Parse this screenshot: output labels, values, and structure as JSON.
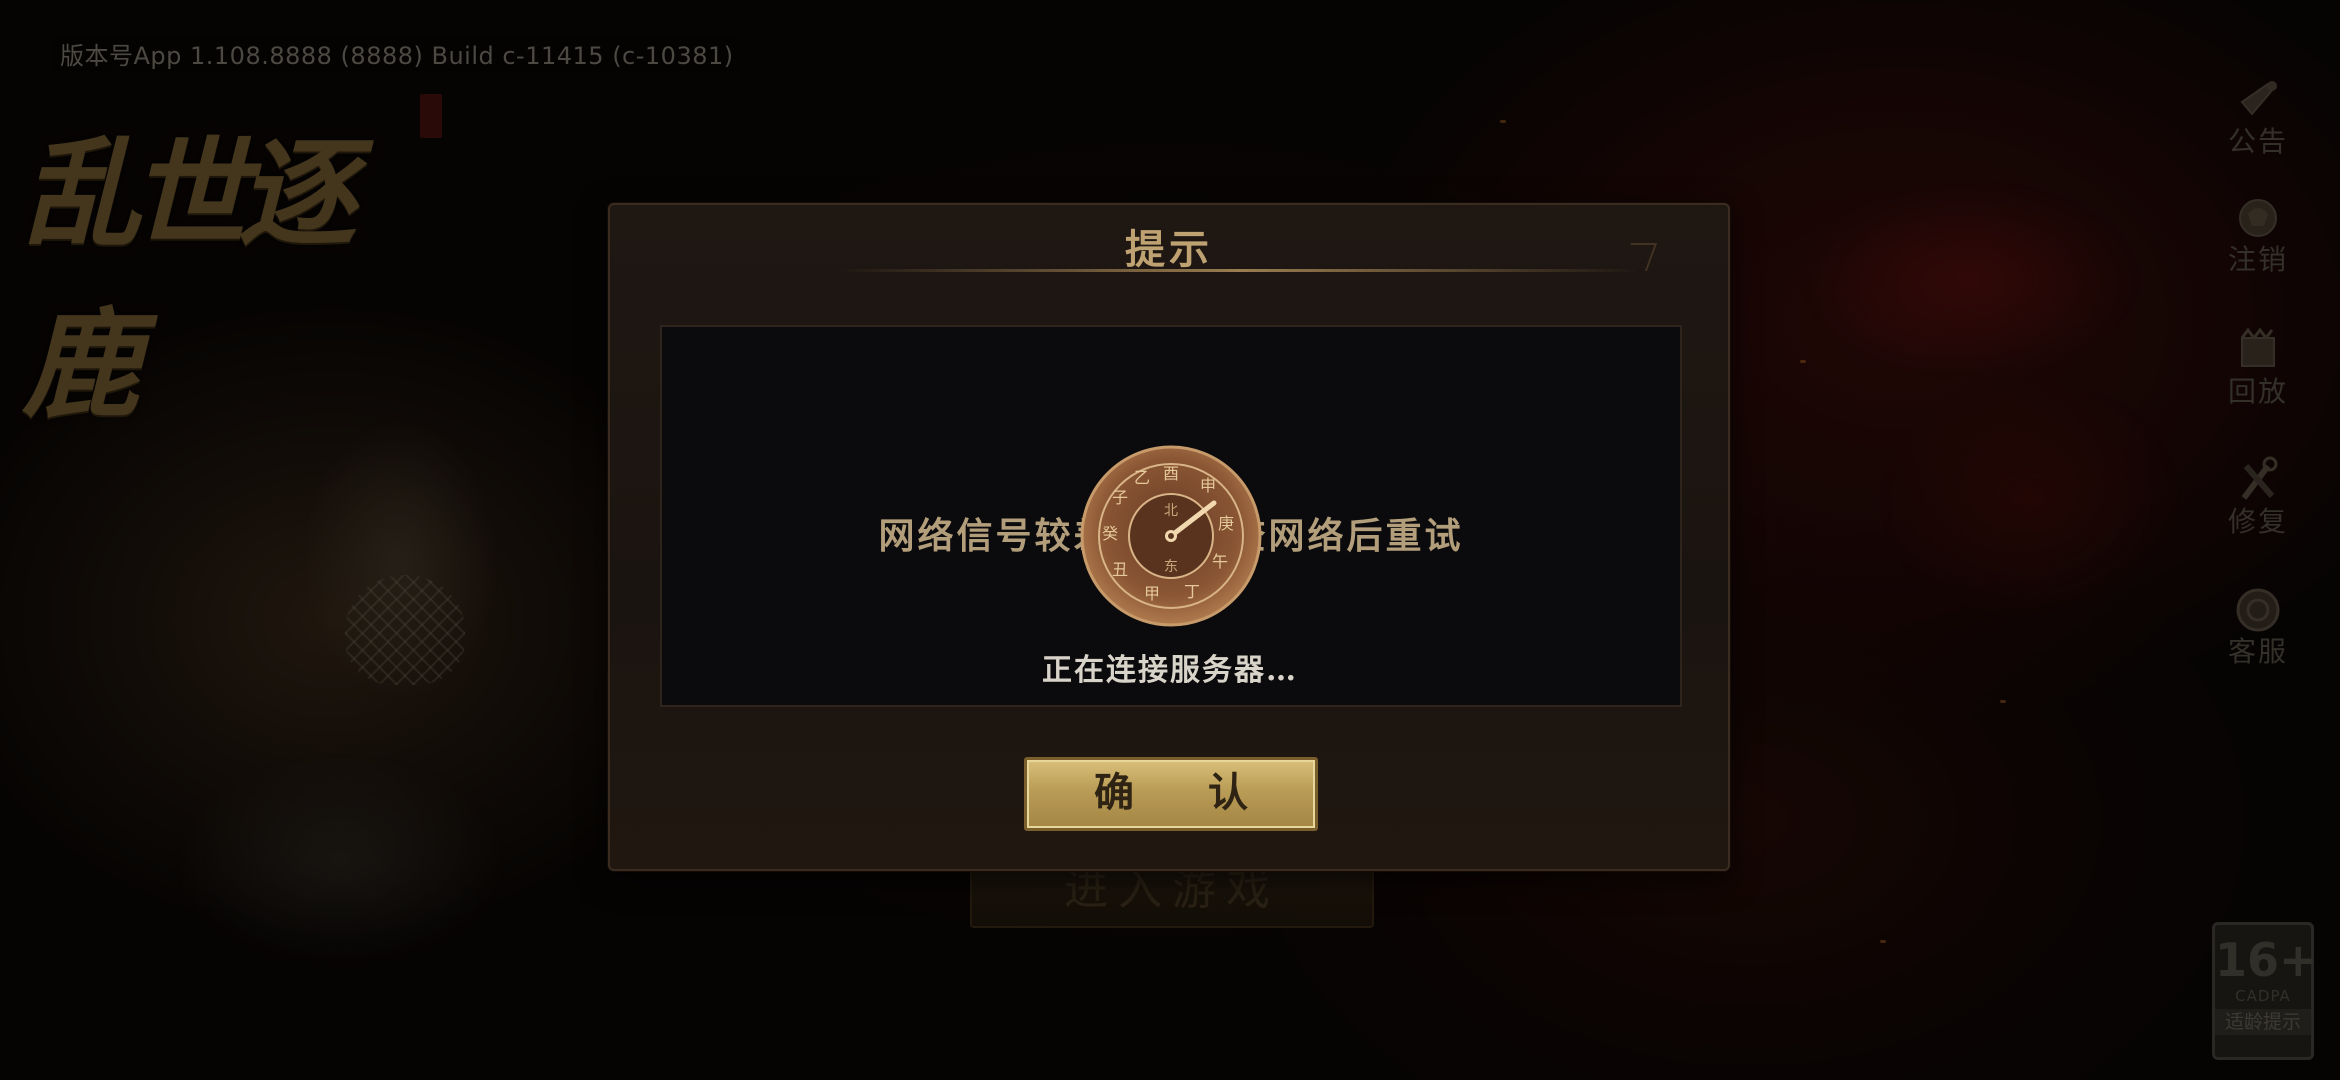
{
  "version_text": "版本号App 1.108.8888 (8888)  Build c-11415 (c-10381)",
  "logo": {
    "title": "乱世逐鹿"
  },
  "side_menu": {
    "items": [
      {
        "label": "公告",
        "icon": "announcement-icon"
      },
      {
        "label": "注销",
        "icon": "logout-icon"
      },
      {
        "label": "回放",
        "icon": "replay-icon"
      },
      {
        "label": "修复",
        "icon": "repair-icon"
      },
      {
        "label": "客服",
        "icon": "customer-service-icon"
      }
    ]
  },
  "background_button": {
    "label": "进入游戏"
  },
  "age_badge": {
    "rating": "16+",
    "org": "CADPA",
    "note": "适龄提示"
  },
  "dialog": {
    "title": "提示",
    "message": "网络信号较差，请检查网络后重试",
    "confirm_label": "确 认"
  },
  "loading": {
    "text": "正在连接服务器…"
  }
}
